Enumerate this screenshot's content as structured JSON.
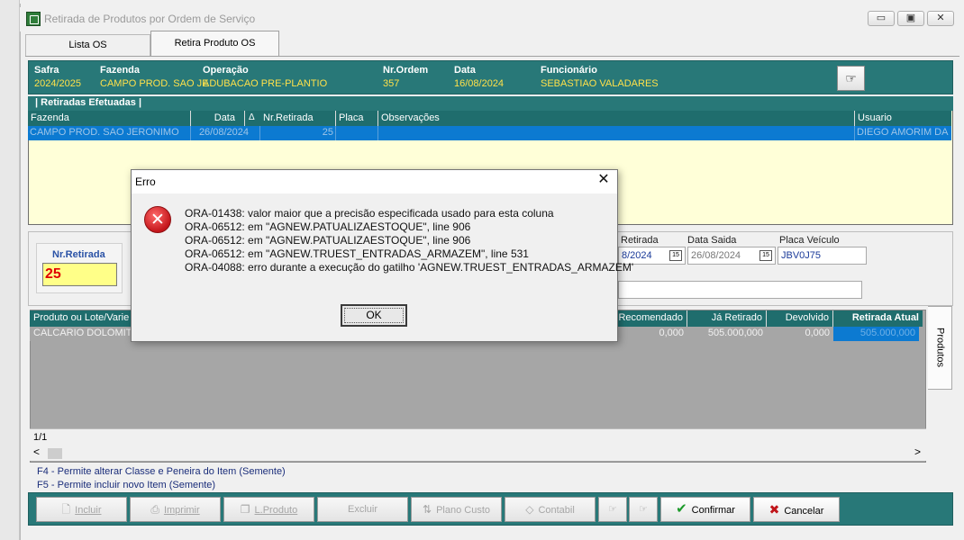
{
  "window": {
    "title": "Retirada de Produtos por Ordem de Serviço",
    "min_glyph": "▭",
    "max_glyph": "▣",
    "close_glyph": "✕"
  },
  "tabs": [
    {
      "label": "Lista OS"
    },
    {
      "label": "Retira Produto OS"
    }
  ],
  "header": {
    "safra_label": "Safra",
    "safra_value": "2024/2025",
    "fazenda_label": "Fazenda",
    "fazenda_value": "CAMPO PROD. SAO JE",
    "operacao_label": "Operação",
    "operacao_value": "ADUBACAO PRE-PLANTIO",
    "nrordem_label": "Nr.Ordem",
    "nrordem_value": "357",
    "data_label": "Data",
    "data_value": "16/08/2024",
    "funcionario_label": "Funcionário",
    "funcionario_value": "SEBASTIAO VALADARES",
    "action_icon": "pointing-hand-icon",
    "action_glyph": "☞"
  },
  "retiradas": {
    "title": "| Retiradas Efetuadas |",
    "columns": [
      "Fazenda",
      "Data",
      "Nr.Retirada",
      "Placa",
      "Observações",
      "Usuario"
    ],
    "sort_glyph": "Δ",
    "rows": [
      {
        "fazenda": "CAMPO PROD. SAO JERONIMO",
        "data": "26/08/2024",
        "nr": "25",
        "placa": "",
        "obs": "",
        "usuario": "DIEGO AMORIM DA"
      }
    ]
  },
  "detail": {
    "nr_label": "Nr.Retirada",
    "nr_value": "25",
    "data_retirada_label": "Retirada",
    "data_retirada_value": "8/2024",
    "data_saida_label": "Data Saida",
    "data_saida_value": "26/08/2024",
    "placa_label": "Placa Veículo",
    "placa_value": "JBV0J75",
    "cal_glyph": "15"
  },
  "products": {
    "columns": [
      "Produto ou  Lote/Varie",
      "Recomendado",
      "Já Retirado",
      "Devolvido",
      "Retirada Atual"
    ],
    "rows": [
      {
        "produto": "CALCARIO DOLOMITIC",
        "recomendado": "0,000",
        "ja_retirado": "505.000,000",
        "devolvido": "0,000",
        "retirada_atual": "505.000,000"
      }
    ],
    "pager": "1/1",
    "side_tab": "Produtos",
    "scroll_left": "<",
    "scroll_right": ">"
  },
  "hints": [
    "F4 - Permite alterar Classe e Peneira do Item (Semente)",
    "F5 - Permite incluir novo Item (Semente)"
  ],
  "toolbar": {
    "incluir": "Incluir",
    "imprimir": "Imprimir",
    "lproduto": "L.Produto",
    "excluir": "Excluir",
    "plano_custo": "Plano Custo",
    "contabil": "Contabil",
    "confirmar": "Confirmar",
    "cancelar": "Cancelar",
    "hand_glyph": "☞",
    "check_glyph": "✔",
    "x_glyph": "✖"
  },
  "dialog": {
    "title": "Erro",
    "close_glyph": "✕",
    "icon_glyph": "✕",
    "lines": [
      "ORA-01438: valor maior que a precisão especificada usado para esta coluna",
      "ORA-06512: em \"AGNEW.PATUALIZAESTOQUE\", line 906",
      "ORA-06512: em \"AGNEW.PATUALIZAESTOQUE\", line 906",
      "ORA-06512: em \"AGNEW.TRUEST_ENTRADAS_ARMAZEM\", line 531",
      "ORA-04088: erro durante a execução do gatilho 'AGNEW.TRUEST_ENTRADAS_ARMAZEM'"
    ],
    "ok_label": "OK"
  },
  "colors": {
    "teal": "#287878",
    "header_value": "#ffe14a",
    "selection": "#0c7ad1",
    "grid_bg": "#ffffd8",
    "error_red": "#c4161b"
  }
}
